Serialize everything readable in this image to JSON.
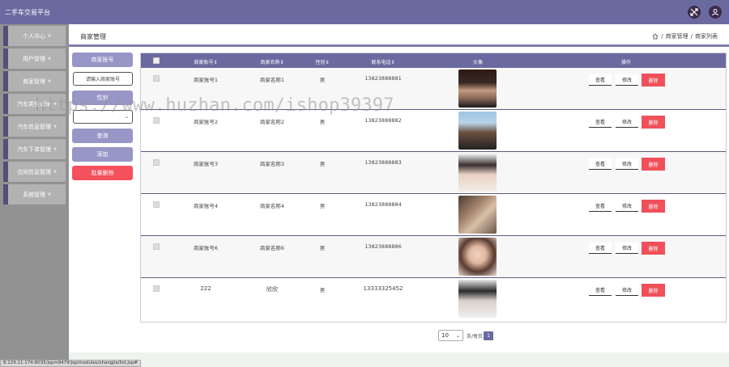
{
  "app": {
    "title": "二手车交易平台"
  },
  "header": {
    "page_title": "商家管理",
    "breadcrumb": [
      "商家管理",
      "商家列表"
    ],
    "separator": "/"
  },
  "sidebar": {
    "items": [
      {
        "label": "个人中心"
      },
      {
        "label": "用户管理"
      },
      {
        "label": "商家管理"
      },
      {
        "label": "汽车类型管理"
      },
      {
        "label": "汽车信息管理"
      },
      {
        "label": "汽车下单管理"
      },
      {
        "label": "合同信息管理"
      },
      {
        "label": "系统管理"
      }
    ]
  },
  "filters": {
    "account_label": "商家账号",
    "account_placeholder": "请输入商家账号",
    "gender_label": "性别",
    "gender_value": "",
    "query_label": "查询",
    "add_label": "添加",
    "batch_delete_label": "批量删除"
  },
  "table": {
    "columns": [
      "商家账号",
      "商家名称",
      "性别",
      "联系电话",
      "头像",
      "操作"
    ],
    "rows": [
      {
        "account": "商家账号1",
        "name": "商家名称1",
        "gender": "男",
        "phone": "13823888881"
      },
      {
        "account": "商家账号2",
        "name": "商家名称2",
        "gender": "男",
        "phone": "13823888882"
      },
      {
        "account": "商家账号3",
        "name": "商家名称3",
        "gender": "男",
        "phone": "13823888883"
      },
      {
        "account": "商家账号4",
        "name": "商家名称4",
        "gender": "男",
        "phone": "13823888884"
      },
      {
        "account": "商家账号6",
        "name": "商家名称6",
        "gender": "男",
        "phone": "13823888886"
      },
      {
        "account": "222",
        "name": "欣欣",
        "gender": "男",
        "phone": "13333325452"
      }
    ],
    "actions": {
      "view": "查看",
      "edit": "修改",
      "delete": "删除"
    }
  },
  "pagination": {
    "page_size": "10",
    "page_size_suffix": "条/每页",
    "current_page": "1"
  },
  "status_bar": {
    "url": "8.129.11.174:8035/jspm9479/jsp/modules/shangjia/list.jsp#"
  },
  "watermark": {
    "text": "https://www.huzhan.com/ishop39397"
  },
  "colors": {
    "header": "#6b6aa0",
    "sidebar": "#929292",
    "delete": "#f0505a",
    "batch_delete": "#f5505d"
  },
  "icons": {
    "topbar": [
      "shuffle-icon",
      "user-icon"
    ],
    "breadcrumb": "home-icon"
  }
}
